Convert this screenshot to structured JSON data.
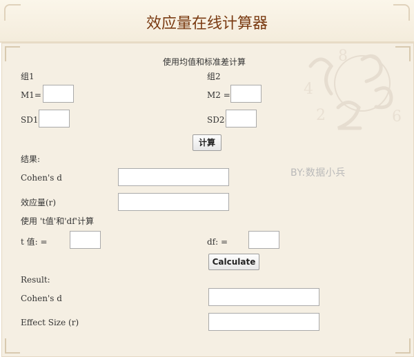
{
  "header": {
    "title": "效应量在线计算器"
  },
  "section_means": {
    "heading": "使用均值和标准差计算",
    "group1_label": "组1",
    "group2_label": "组2",
    "m1_label": "M1=",
    "m2_label": "M2 =",
    "sd1_label": "SD1=",
    "sd2_label": "SD2=",
    "m1_value": "",
    "m2_value": "",
    "sd1_value": "",
    "sd2_value": "",
    "calc_button": "计算"
  },
  "results_means": {
    "label": "结果:",
    "cohens_d_label": "Cohen's d",
    "effect_r_label": "效应量(r)",
    "cohens_d_value": "",
    "effect_r_value": ""
  },
  "section_t": {
    "heading": "使用 't值'和'df'计算",
    "t_label": "t 值: =",
    "df_label": "df: =",
    "t_value": "",
    "df_value": "",
    "calc_button": "Calculate"
  },
  "results_t": {
    "label": "Result:",
    "cohens_d_label": "Cohen's d",
    "effect_size_label": "Effect Size (r)",
    "cohens_d_value": "",
    "effect_size_value": ""
  },
  "watermark": "BY:数据小兵",
  "colors": {
    "title": "#7a3b12",
    "panel_bg": "#f5efe3",
    "header_bg": "#fbf6ea"
  }
}
